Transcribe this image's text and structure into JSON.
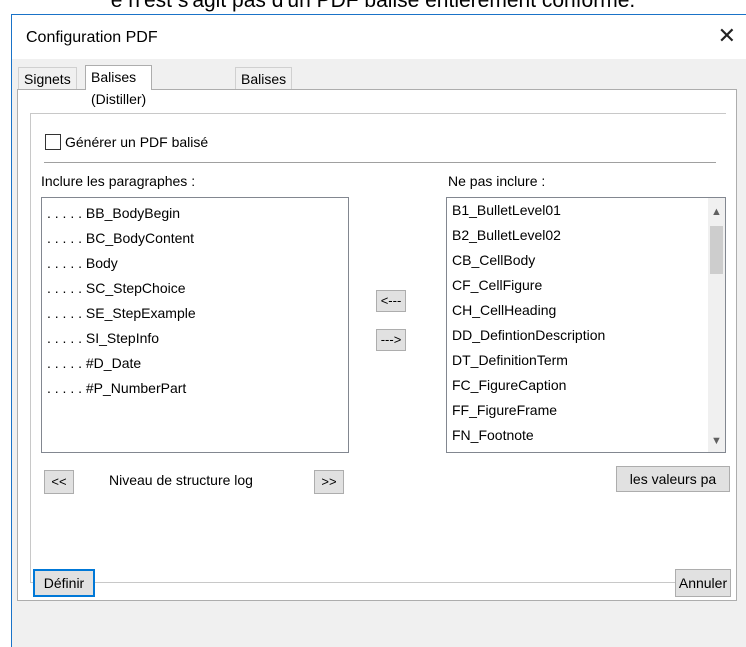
{
  "background_caption": "e n'est s'agit pas d'un PDF balisé entièrement conforme.",
  "dialog": {
    "title": "Configuration PDF",
    "close_glyph": "✕"
  },
  "tabs": [
    {
      "label": "Signets",
      "active": false
    },
    {
      "label": "Balises (Distiller)",
      "active": true
    },
    {
      "label": "Balises",
      "active": false
    }
  ],
  "tagged_pdf": {
    "label": "Générer un PDF balisé",
    "checked": false
  },
  "include": {
    "label": "Inclure les paragraphes :",
    "items": [
      ". . . . . BB_BodyBegin",
      ". . . . . BC_BodyContent",
      ". . . . . Body",
      ". . . . . SC_StepChoice",
      ". . . . . SE_StepExample",
      ". . . . . SI_StepInfo",
      ". . . . . #D_Date",
      ". . . . . #P_NumberPart"
    ]
  },
  "exclude": {
    "label": "Ne pas inclure :",
    "items": [
      "B1_BulletLevel01",
      "B2_BulletLevel02",
      "CB_CellBody",
      "CF_CellFigure",
      "CH_CellHeading",
      "DD_DefintionDescription",
      "DT_DefinitionTerm",
      "FC_FigureCaption",
      "FF_FigureFrame",
      "FN_Footnote"
    ]
  },
  "move_left_label": "<---",
  "move_right_label": "--->",
  "level": {
    "prev_label": "<<",
    "text": "Niveau de structure log",
    "next_label": ">>"
  },
  "defaults_button_label": "les valeurs pa",
  "define_button_label": "Définir",
  "cancel_button_label": "Annuler",
  "colors": {
    "dialog_border": "#1a73c8",
    "default_button_border": "#0078d7",
    "dialog_background": "#f0f0f0"
  }
}
